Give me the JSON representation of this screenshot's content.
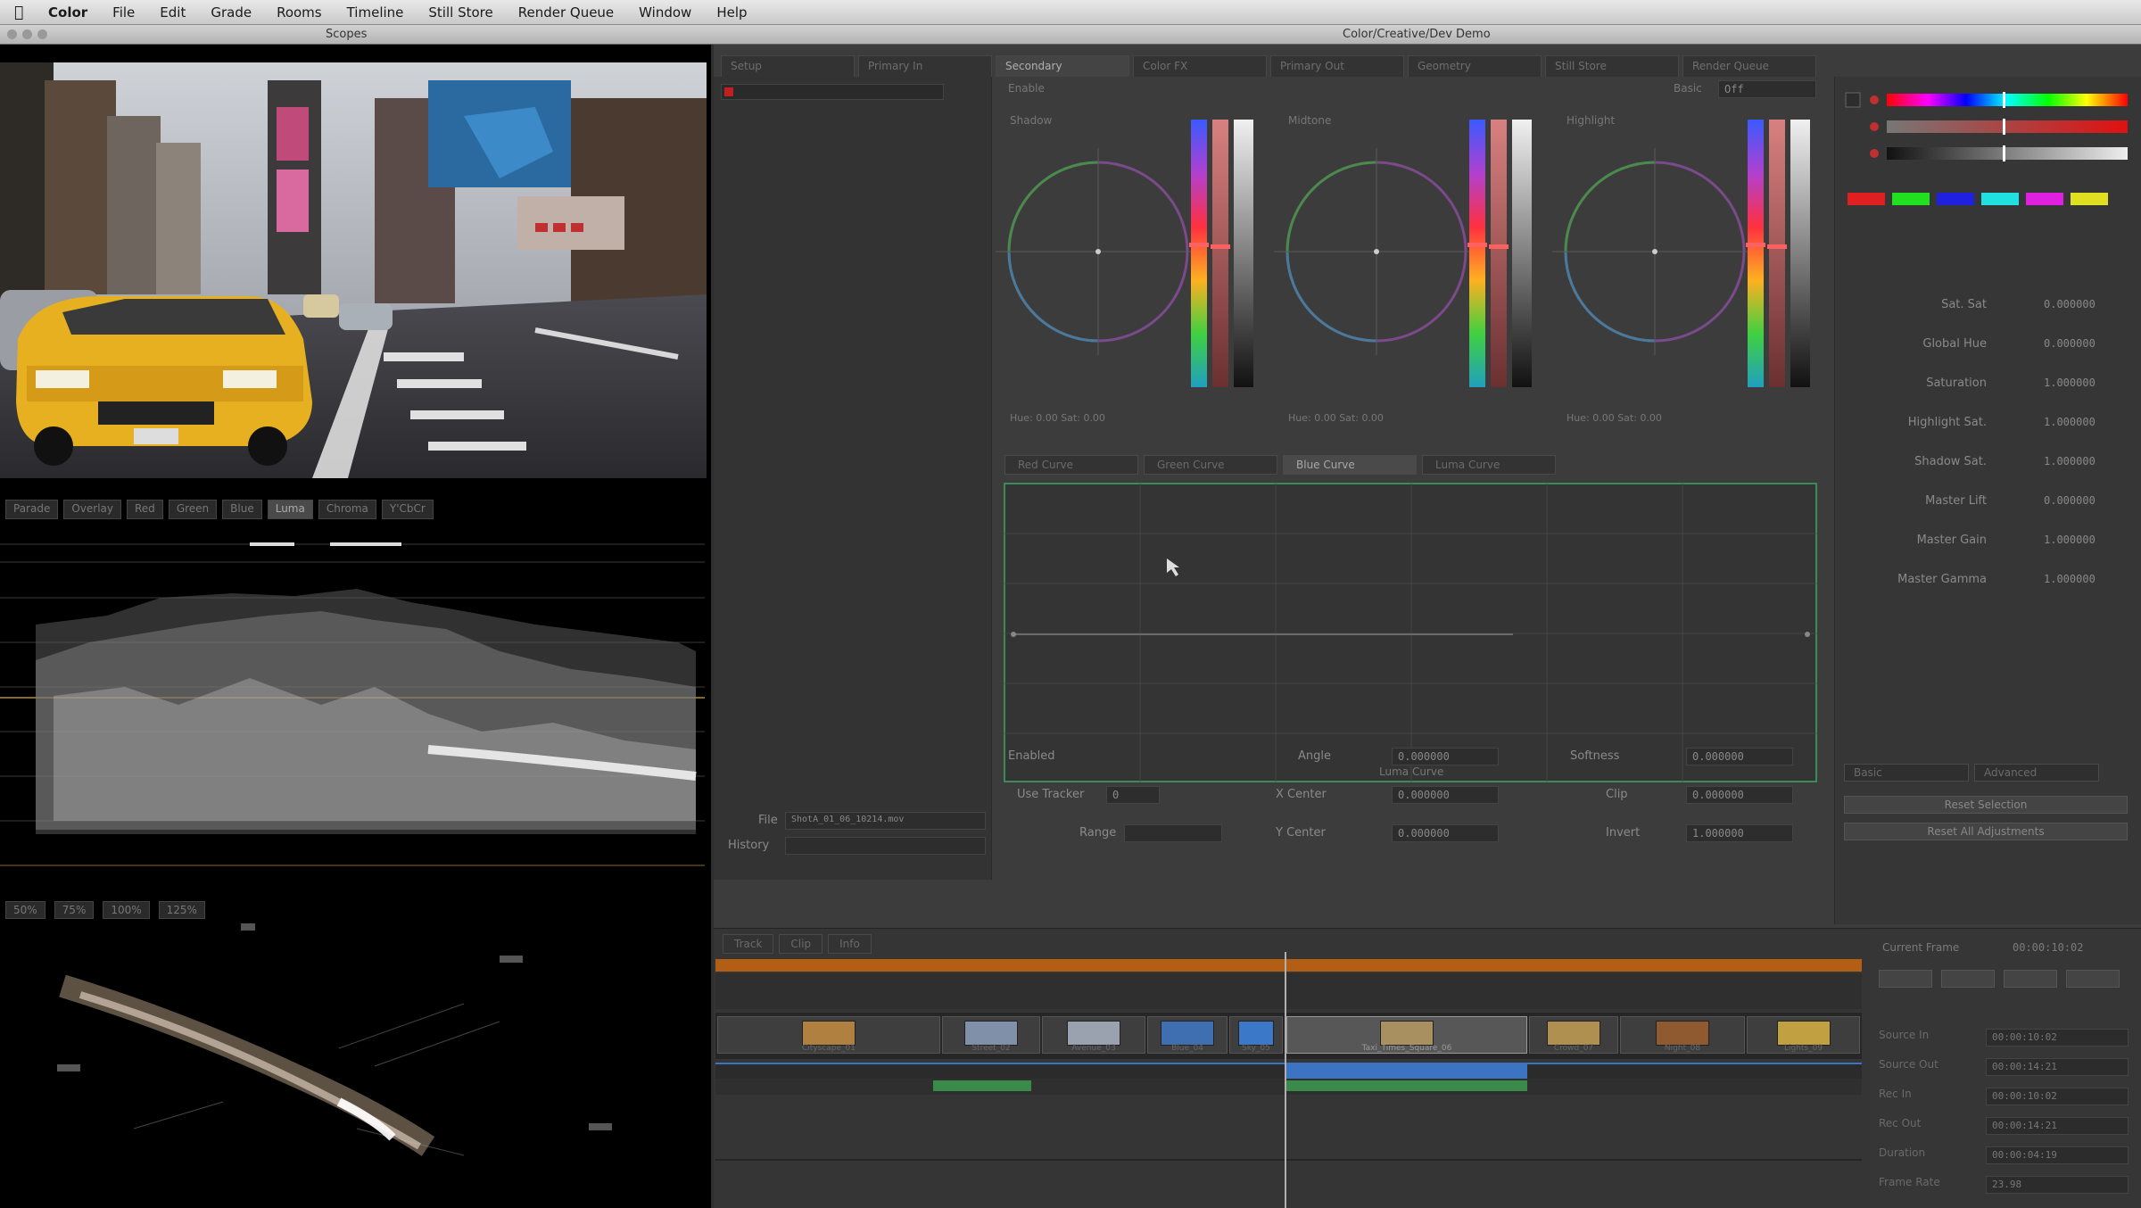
{
  "menubar": {
    "app_name": "Color",
    "items": [
      "File",
      "Edit",
      "Grade",
      "Rooms",
      "Timeline",
      "Still Store",
      "Render Queue",
      "Window",
      "Help"
    ]
  },
  "window": {
    "left_title": "Scopes",
    "right_title": "Color/Creative/Dev Demo"
  },
  "scope_tabs": [
    "Parade",
    "Overlay",
    "Red",
    "Green",
    "Blue",
    "Luma",
    "Chroma",
    "Y'CbCr"
  ],
  "vector_tabs": [
    "50%",
    "75%",
    "100%",
    "125%"
  ],
  "room_tabs": [
    "Setup",
    "Primary In",
    "Secondary",
    "Color FX",
    "Primary Out",
    "Geometry",
    "Still Store",
    "Render Queue"
  ],
  "wheels": {
    "labels": [
      "Shadow",
      "Midtone",
      "Highlight"
    ],
    "readouts": [
      "Hue: 0.00  Sat: 0.00",
      "Hue: 0.00  Sat: 0.00",
      "Hue: 0.00  Sat: 0.00"
    ],
    "enabled_label": "Enable",
    "basic_label": "Basic",
    "basic_value": "Off"
  },
  "curve_tabs": [
    "Red Curve",
    "Green Curve",
    "Blue Curve",
    "Luma Curve"
  ],
  "curve_label": "Luma Curve",
  "controls": {
    "enabled": "Enabled",
    "angle_label": "Angle",
    "angle_value": "0.000000",
    "softness_label": "Softness",
    "softness_value": "0.000000",
    "use_tracker_label": "Use Tracker",
    "use_tracker_value": "0",
    "x_center_label": "X Center",
    "x_center_value": "0.000000",
    "clip_label": "Clip",
    "clip_value": "0.000000",
    "y_center_label": "Y Center",
    "y_center_value": "0.000000",
    "invert_label": "Invert",
    "invert_value": "1.000000",
    "range_label": "Range",
    "file_label": "File",
    "file_value": "ShotA_01_06_10214.mov",
    "history_label": "History"
  },
  "params": [
    {
      "label": "Sat. Sat",
      "value": "0.000000"
    },
    {
      "label": "Global Hue",
      "value": "0.000000"
    },
    {
      "label": "Saturation",
      "value": "1.000000"
    },
    {
      "label": "Highlight Sat.",
      "value": "1.000000"
    },
    {
      "label": "Shadow Sat.",
      "value": "1.000000"
    },
    {
      "label": "Master Lift",
      "value": "0.000000"
    },
    {
      "label": "Master Gain",
      "value": "1.000000"
    },
    {
      "label": "Master Gamma",
      "value": "1.000000"
    }
  ],
  "side_tabs": [
    "Basic",
    "Advanced"
  ],
  "side_buttons": [
    "Reset Selection",
    "Reset All Adjustments"
  ],
  "timeline_tabs": [
    "Track",
    "Clip",
    "Info"
  ],
  "timeline_right": {
    "header_label": "Current Frame",
    "header_value": "00:00:10:02",
    "rows": [
      {
        "label": "Source In",
        "value": "00:00:10:02"
      },
      {
        "label": "Source Out",
        "value": "00:00:14:21"
      },
      {
        "label": "Rec In",
        "value": "00:00:10:02"
      },
      {
        "label": "Rec Out",
        "value": "00:00:14:21"
      },
      {
        "label": "Duration",
        "value": "00:00:04:19"
      },
      {
        "label": "Frame Rate",
        "value": "23.98"
      }
    ]
  },
  "clips": [
    {
      "caption": "Cityscape_01"
    },
    {
      "caption": "Street_02"
    },
    {
      "caption": "Avenue_03"
    },
    {
      "caption": "Blue_04"
    },
    {
      "caption": "Sky_05"
    },
    {
      "caption": "Taxi_Times_Square_06"
    },
    {
      "caption": "Crowd_07"
    },
    {
      "caption": "Night_08"
    },
    {
      "caption": "Lights_09"
    }
  ],
  "colors": {
    "accent_orange": "#b25e14",
    "track_blue": "#3b73c2",
    "curve_border": "#3a8a5a",
    "taxi_yellow": "#e6b020"
  }
}
